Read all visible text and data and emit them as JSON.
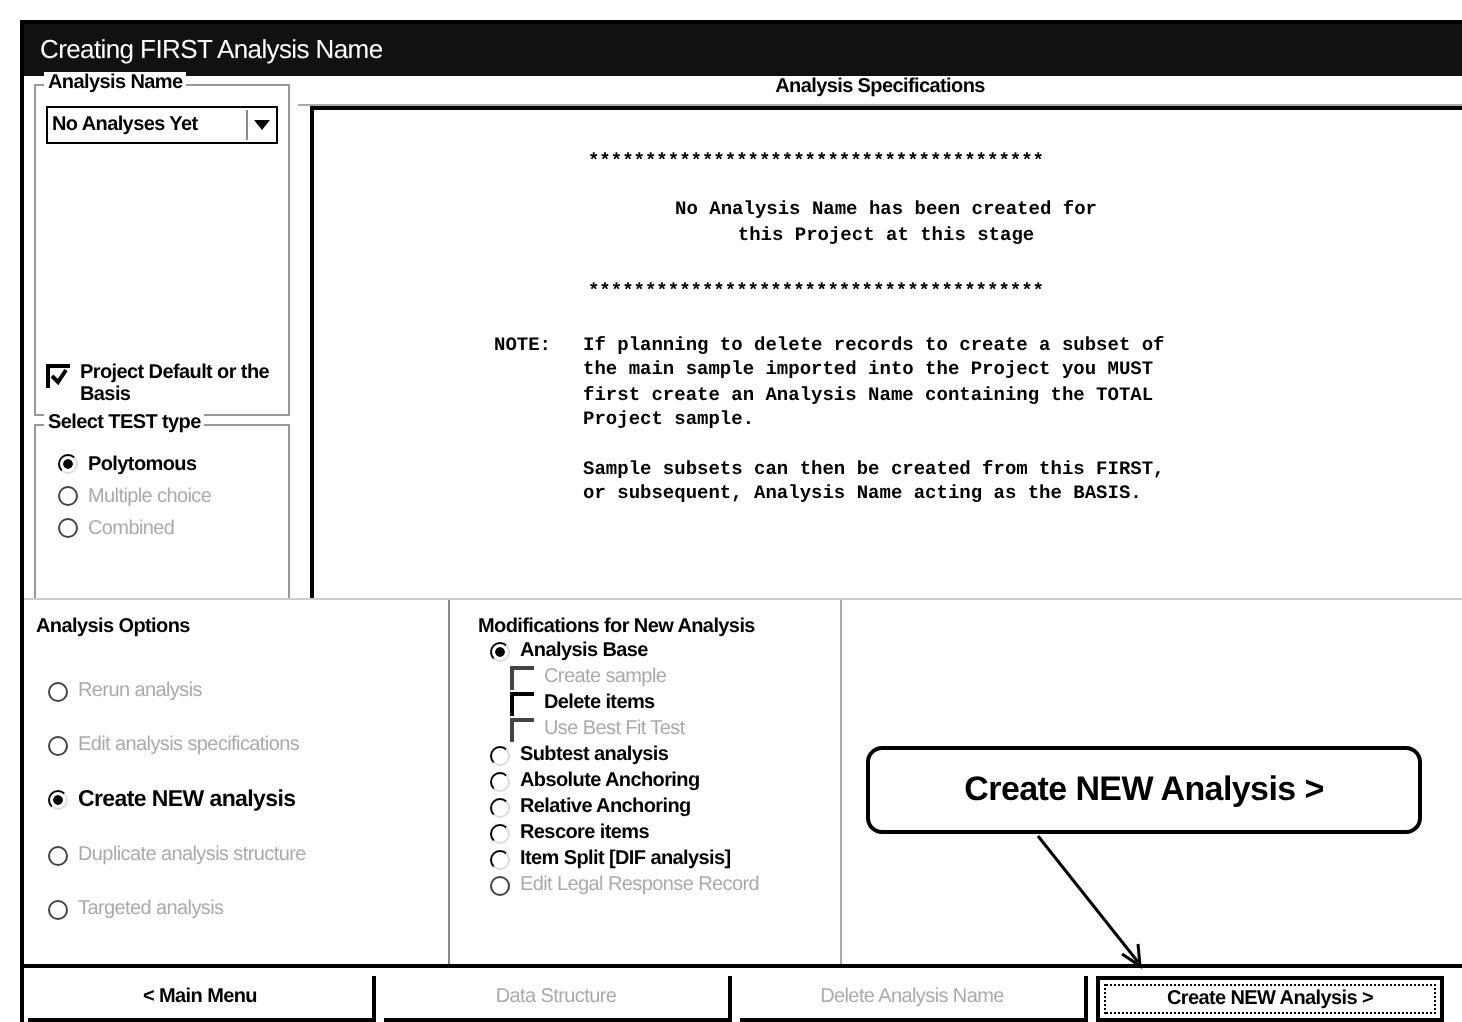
{
  "window": {
    "title": "Creating FIRST Analysis Name"
  },
  "analysis_name": {
    "legend": "Analysis Name",
    "dropdown": {
      "value": "No Analyses Yet"
    },
    "project_default": {
      "label": "Project Default or the Basis",
      "checked": true
    }
  },
  "test_type": {
    "legend": "Select TEST type",
    "options": [
      {
        "label": "Polytomous",
        "selected": true,
        "disabled": false
      },
      {
        "label": "Multiple choice",
        "selected": false,
        "disabled": true
      },
      {
        "label": "Combined",
        "selected": false,
        "disabled": true
      }
    ]
  },
  "specifications": {
    "title": "Analysis Specifications",
    "stars": "****************************************",
    "heading": [
      "No Analysis Name has been created for",
      "this Project at this stage"
    ],
    "note_label": "NOTE:",
    "paragraphs": [
      "If planning to delete records to create a subset of\nthe main sample imported into the Project you MUST\nfirst create an Analysis Name containing the TOTAL\nProject sample.",
      "Sample subsets can then be created from this FIRST,\nor subsequent, Analysis Name acting as the BASIS."
    ]
  },
  "analysis_options": {
    "legend": "Analysis Options",
    "options": [
      {
        "label": "Rerun analysis",
        "selected": false,
        "disabled": true
      },
      {
        "label": "Edit analysis specifications",
        "selected": false,
        "disabled": true
      },
      {
        "label": "Create NEW analysis",
        "selected": true,
        "disabled": false
      },
      {
        "label": "Duplicate analysis structure",
        "selected": false,
        "disabled": true
      },
      {
        "label": "Targeted analysis",
        "selected": false,
        "disabled": true
      }
    ]
  },
  "modifications": {
    "legend": "Modifications for New Analysis",
    "options": [
      {
        "label": "Analysis Base",
        "selected": true,
        "disabled": false,
        "children": [
          {
            "label": "Create sample",
            "checked": false,
            "disabled": true
          },
          {
            "label": "Delete items",
            "checked": false,
            "disabled": false
          },
          {
            "label": "Use Best Fit Test",
            "checked": false,
            "disabled": true
          }
        ]
      },
      {
        "label": "Subtest analysis",
        "selected": false,
        "disabled": false
      },
      {
        "label": "Absolute Anchoring",
        "selected": false,
        "disabled": false
      },
      {
        "label": "Relative Anchoring",
        "selected": false,
        "disabled": false
      },
      {
        "label": "Rescore items",
        "selected": false,
        "disabled": false
      },
      {
        "label": "Item Split [DIF analysis]",
        "selected": false,
        "disabled": false
      },
      {
        "label": "Edit Legal Response Record",
        "selected": false,
        "disabled": true
      }
    ]
  },
  "callout": {
    "text": "Create NEW Analysis >"
  },
  "buttons": [
    {
      "label": "< Main Menu",
      "disabled": false,
      "focused": false
    },
    {
      "label": "Data Structure",
      "disabled": true,
      "focused": false
    },
    {
      "label": "Delete Analysis Name",
      "disabled": true,
      "focused": false
    },
    {
      "label": "Create NEW Analysis >",
      "disabled": false,
      "focused": true
    }
  ]
}
